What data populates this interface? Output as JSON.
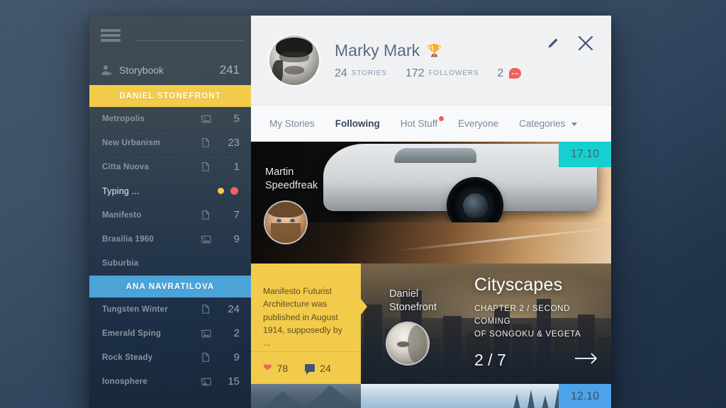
{
  "sidebar": {
    "menu_icon": "hamburger-icon",
    "search": {
      "value": "",
      "placeholder": ""
    },
    "search_icon": "search-icon",
    "storybook": {
      "label": "Storybook",
      "count": "241",
      "icon": "person-icon"
    },
    "groups": [
      {
        "header": "DANIEL STONEFRONT",
        "color": "#f2cb4a",
        "items": [
          {
            "label": "Metropolis",
            "icon": "photo-icon",
            "count": "5"
          },
          {
            "label": "New Urbanism",
            "icon": "document-icon",
            "count": "23"
          },
          {
            "label": "Citta Nuova",
            "icon": "document-icon",
            "count": "1"
          },
          {
            "label": "Typing ...",
            "icon": "status-dots",
            "count": "",
            "typing": true
          },
          {
            "label": "Manifesto",
            "icon": "document-icon",
            "count": "7"
          },
          {
            "label": "Brasilia 1960",
            "icon": "photo-icon",
            "count": "9"
          },
          {
            "label": "Suburbia",
            "icon": "",
            "count": ""
          }
        ]
      },
      {
        "header": "ANA NAVRATILOVA",
        "color": "#4ba3d8",
        "items": [
          {
            "label": "Tungsten Winter",
            "icon": "document-icon",
            "count": "24"
          },
          {
            "label": "Emerald Sping",
            "icon": "photo-icon",
            "count": "2"
          },
          {
            "label": "Rock Steady",
            "icon": "document-icon",
            "count": "9"
          },
          {
            "label": "Ionosphere",
            "icon": "photo-icon",
            "count": "15"
          }
        ]
      }
    ]
  },
  "profile": {
    "name": "Marky Mark",
    "trophy_icon": "trophy-icon",
    "stats": [
      {
        "num": "24",
        "label": "STORIES"
      },
      {
        "num": "172",
        "label": "FOLLOWERS"
      }
    ],
    "messages": {
      "count": "2",
      "icon": "message-badge-icon"
    },
    "actions": [
      {
        "name": "edit-icon"
      },
      {
        "name": "close-icon"
      }
    ]
  },
  "tabs": [
    {
      "label": "My Stories",
      "active": false,
      "dot": false,
      "caret": false
    },
    {
      "label": "Following",
      "active": true,
      "dot": false,
      "caret": false
    },
    {
      "label": "Hot Stuff",
      "active": false,
      "dot": true,
      "caret": false
    },
    {
      "label": "Everyone",
      "active": false,
      "dot": false,
      "caret": false
    },
    {
      "label": "Categories",
      "active": false,
      "dot": false,
      "caret": true
    }
  ],
  "feed": {
    "car_card": {
      "author_line1": "Martin",
      "author_line2": "Speedfreak",
      "date_badge": "17.10",
      "badge_color": "#16cfd0"
    },
    "manifesto_card": {
      "excerpt": "Manifesto Futurist Architecture was published in August 1914, supposedly by ...",
      "likes": "78",
      "comments": "24",
      "bg_color": "#f2cb4a"
    },
    "city_card": {
      "author_line1": "Daniel",
      "author_line2": "Stonefront",
      "title": "Cityscapes",
      "subtitle_line1": "CHAPTER 2 / SECOND COMING",
      "subtitle_line2": "OF SONGOKU & VEGETA",
      "page": "2 / 7",
      "next_icon": "arrow-right-icon"
    },
    "bottom_card": {
      "date_badge": "12.10",
      "badge_color": "#4ea3e8"
    }
  }
}
